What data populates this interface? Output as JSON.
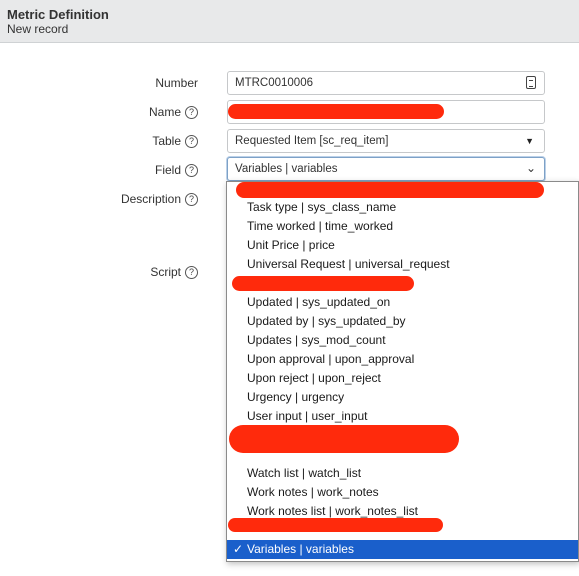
{
  "header": {
    "title": "Metric Definition",
    "subtitle": "New record"
  },
  "form": {
    "number": {
      "label": "Number",
      "value": "MTRC0010006"
    },
    "name": {
      "label": "Name",
      "value": ""
    },
    "table": {
      "label": "Table",
      "value": "Requested Item [sc_req_item]"
    },
    "field": {
      "label": "Field",
      "value": "Variables | variables"
    },
    "description": {
      "label": "Description"
    },
    "script": {
      "label": "Script"
    }
  },
  "dropdown": {
    "options": [
      "Task type | sys_class_name",
      "Time worked | time_worked",
      "Unit Price | price",
      "Universal Request | universal_request",
      "Updated | sys_updated_on",
      "Updated by | sys_updated_by",
      "Updates | sys_mod_count",
      "Upon approval | upon_approval",
      "Upon reject | upon_reject",
      "Urgency | urgency",
      "User input | user_input",
      "Watch list | watch_list",
      "Work notes | work_notes",
      "Work notes list | work_notes_list"
    ],
    "selected": "Variables | variables",
    "check": "✓"
  },
  "icons": {
    "help": "?",
    "select_caret": "▼",
    "select_chevron": "⌄"
  },
  "colors": {
    "redaction": "#ff2a0c",
    "selected_bg": "#1a5fcb"
  }
}
